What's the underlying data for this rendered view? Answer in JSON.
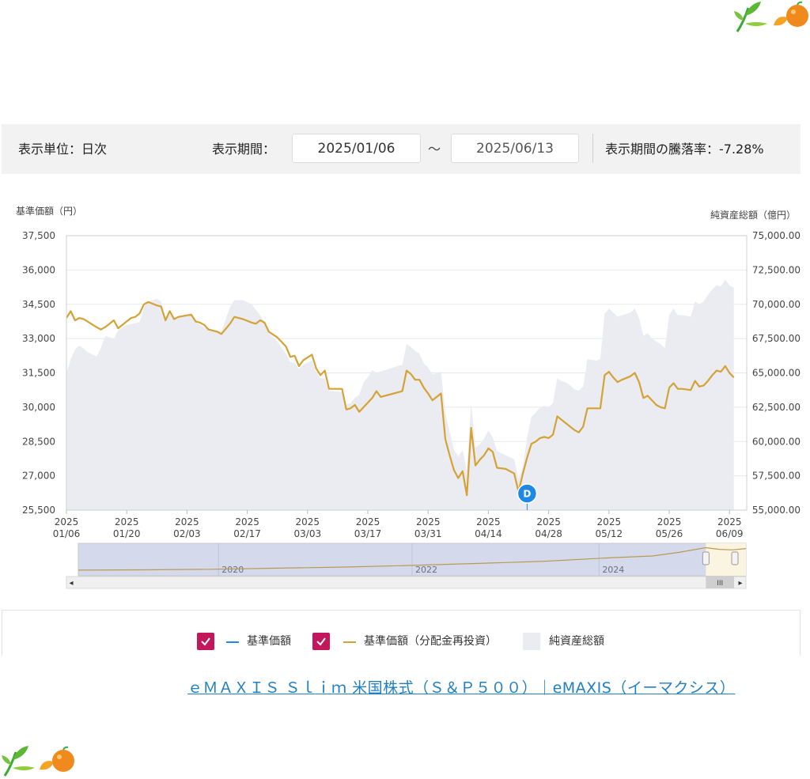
{
  "filter": {
    "unit_label": "表示単位：日次",
    "period_label": "表示期間：",
    "start_date": "2025/01/06",
    "tilde": "～",
    "end_date": "2025/06/13",
    "change_label": "表示期間の騰落率：-7.28%"
  },
  "legend": {
    "item1": "基準価額",
    "item2": "基準価額（分配金再投資）",
    "item3": "純資産総額",
    "checkbox_color": "#c2185b",
    "item1_color": "#1e88e5",
    "item2_color": "#d4a235",
    "area_color": "#eaecf2"
  },
  "link_text": "ｅＭＡＸＩＳ Ｓｌｉｍ 米国株式（Ｓ＆Ｐ５００）｜eMAXIS（イーマクシス）",
  "chart_data": {
    "type": "line",
    "ylabel": "基準価額（円）",
    "y2label": "純資産総額（億円）",
    "ylim": [
      25500,
      37500
    ],
    "y2lim": [
      55000,
      75000
    ],
    "y_ticks": [
      "37,500",
      "36,000",
      "34,500",
      "33,000",
      "31,500",
      "30,000",
      "28,500",
      "27,000",
      "25,500"
    ],
    "y2_ticks": [
      "75,000.00",
      "72,500.00",
      "70,000.00",
      "67,500.00",
      "65,000.00",
      "62,500.00",
      "60,000.00",
      "57,500.00",
      "55,000.00"
    ],
    "x_ticks": [
      {
        "year": "2025",
        "date": "01/06",
        "pos": 0
      },
      {
        "year": "2025",
        "date": "01/20",
        "pos": 14
      },
      {
        "year": "2025",
        "date": "02/03",
        "pos": 28
      },
      {
        "year": "2025",
        "date": "02/17",
        "pos": 42
      },
      {
        "year": "2025",
        "date": "03/03",
        "pos": 56
      },
      {
        "year": "2025",
        "date": "03/17",
        "pos": 70
      },
      {
        "year": "2025",
        "date": "03/31",
        "pos": 84
      },
      {
        "year": "2025",
        "date": "04/14",
        "pos": 98
      },
      {
        "year": "2025",
        "date": "04/28",
        "pos": 112
      },
      {
        "year": "2025",
        "date": "05/12",
        "pos": 126
      },
      {
        "year": "2025",
        "date": "05/26",
        "pos": 140
      },
      {
        "year": "2025",
        "date": "06/09",
        "pos": 154
      }
    ],
    "x_range": [
      0,
      158
    ],
    "series": [
      {
        "name": "基準価額（分配金再投資）",
        "color": "#d4a235",
        "points": [
          [
            0,
            33900
          ],
          [
            1,
            34200
          ],
          [
            2,
            33800
          ],
          [
            3,
            33900
          ],
          [
            4,
            33850
          ],
          [
            7,
            33500
          ],
          [
            8,
            33400
          ],
          [
            9,
            33500
          ],
          [
            11,
            33800
          ],
          [
            12,
            33450
          ],
          [
            13,
            33600
          ],
          [
            15,
            33900
          ],
          [
            16,
            33950
          ],
          [
            17,
            34100
          ],
          [
            18,
            34500
          ],
          [
            19,
            34600
          ],
          [
            21,
            34450
          ],
          [
            22,
            34400
          ],
          [
            23,
            33800
          ],
          [
            24,
            34200
          ],
          [
            25,
            33850
          ],
          [
            26,
            33950
          ],
          [
            29,
            34050
          ],
          [
            30,
            33750
          ],
          [
            31,
            33700
          ],
          [
            32,
            33600
          ],
          [
            33,
            33400
          ],
          [
            35,
            33300
          ],
          [
            36,
            33200
          ],
          [
            38,
            33650
          ],
          [
            39,
            33950
          ],
          [
            41,
            33850
          ],
          [
            43,
            33700
          ],
          [
            44,
            33650
          ],
          [
            45,
            33800
          ],
          [
            46,
            33700
          ],
          [
            47,
            33300
          ],
          [
            49,
            33050
          ],
          [
            50,
            32850
          ],
          [
            51,
            32650
          ],
          [
            52,
            32200
          ],
          [
            53,
            32250
          ],
          [
            54,
            31800
          ],
          [
            55,
            32050
          ],
          [
            57,
            32300
          ],
          [
            58,
            31700
          ],
          [
            59,
            31400
          ],
          [
            60,
            31600
          ],
          [
            61,
            30800
          ],
          [
            64,
            30800
          ],
          [
            65,
            29900
          ],
          [
            66,
            29950
          ],
          [
            67,
            30100
          ],
          [
            68,
            29800
          ],
          [
            71,
            30400
          ],
          [
            72,
            30700
          ],
          [
            73,
            30450
          ],
          [
            75,
            30550
          ],
          [
            77,
            30650
          ],
          [
            78,
            30700
          ],
          [
            79,
            31600
          ],
          [
            80,
            31450
          ],
          [
            81,
            31200
          ],
          [
            82,
            31200
          ],
          [
            83,
            30850
          ],
          [
            84,
            30600
          ],
          [
            85,
            30300
          ],
          [
            86,
            30450
          ],
          [
            87,
            30600
          ],
          [
            88,
            28600
          ],
          [
            89,
            27900
          ],
          [
            90,
            27250
          ],
          [
            91,
            26900
          ],
          [
            92,
            27200
          ],
          [
            93,
            26150
          ],
          [
            94,
            29100
          ],
          [
            95,
            27450
          ],
          [
            96,
            27700
          ],
          [
            97,
            27900
          ],
          [
            98,
            28200
          ],
          [
            99,
            28050
          ],
          [
            100,
            27350
          ],
          [
            102,
            27300
          ],
          [
            104,
            27100
          ],
          [
            105,
            26300
          ],
          [
            106,
            27100
          ],
          [
            107,
            27800
          ],
          [
            108,
            28400
          ],
          [
            109,
            28500
          ],
          [
            110,
            28650
          ],
          [
            111,
            28700
          ],
          [
            112,
            28650
          ],
          [
            113,
            28800
          ],
          [
            114,
            29600
          ],
          [
            115,
            29450
          ],
          [
            116,
            29300
          ],
          [
            117,
            29150
          ],
          [
            118,
            29000
          ],
          [
            119,
            28900
          ],
          [
            120,
            29150
          ],
          [
            121,
            29950
          ],
          [
            123,
            29950
          ],
          [
            124,
            29950
          ],
          [
            125,
            31400
          ],
          [
            126,
            31550
          ],
          [
            127,
            31300
          ],
          [
            128,
            31100
          ],
          [
            129,
            31200
          ],
          [
            131,
            31350
          ],
          [
            132,
            31500
          ],
          [
            133,
            31100
          ],
          [
            134,
            30400
          ],
          [
            135,
            30500
          ],
          [
            136,
            30300
          ],
          [
            137,
            30100
          ],
          [
            138,
            30000
          ],
          [
            139,
            29950
          ],
          [
            140,
            30850
          ],
          [
            141,
            31050
          ],
          [
            142,
            30800
          ],
          [
            143,
            30800
          ],
          [
            145,
            30750
          ],
          [
            146,
            31150
          ],
          [
            147,
            30900
          ],
          [
            148,
            30950
          ],
          [
            149,
            31150
          ],
          [
            150,
            31400
          ],
          [
            151,
            31600
          ],
          [
            152,
            31550
          ],
          [
            153,
            31800
          ],
          [
            154,
            31500
          ],
          [
            155,
            31300
          ]
        ]
      },
      {
        "name": "純資産総額",
        "color": "#eaecf2",
        "points": [
          [
            0,
            65000
          ],
          [
            1,
            66000
          ],
          [
            2,
            66700
          ],
          [
            3,
            67000
          ],
          [
            5,
            66500
          ],
          [
            7,
            66200
          ],
          [
            8,
            66800
          ],
          [
            9,
            67700
          ],
          [
            11,
            67500
          ],
          [
            12,
            68100
          ],
          [
            14,
            68500
          ],
          [
            17,
            68700
          ],
          [
            18,
            69800
          ],
          [
            19,
            70200
          ],
          [
            21,
            70400
          ],
          [
            22,
            70200
          ],
          [
            23,
            68800
          ],
          [
            24,
            69300
          ],
          [
            25,
            68900
          ],
          [
            29,
            69300
          ],
          [
            30,
            68700
          ],
          [
            31,
            68500
          ],
          [
            32,
            68300
          ],
          [
            36,
            68000
          ],
          [
            37,
            68900
          ],
          [
            38,
            69800
          ],
          [
            39,
            70300
          ],
          [
            41,
            70300
          ],
          [
            43,
            70000
          ],
          [
            44,
            69600
          ],
          [
            45,
            69200
          ],
          [
            46,
            68700
          ],
          [
            47,
            67900
          ],
          [
            49,
            67300
          ],
          [
            50,
            66800
          ],
          [
            51,
            66400
          ],
          [
            52,
            65800
          ],
          [
            53,
            65700
          ],
          [
            54,
            65300
          ],
          [
            55,
            65600
          ],
          [
            57,
            65900
          ],
          [
            58,
            65100
          ],
          [
            59,
            64600
          ],
          [
            60,
            64600
          ],
          [
            61,
            63700
          ],
          [
            64,
            63600
          ],
          [
            65,
            62700
          ],
          [
            66,
            62800
          ],
          [
            67,
            63200
          ],
          [
            68,
            63400
          ],
          [
            69,
            64300
          ],
          [
            70,
            64700
          ],
          [
            71,
            65200
          ],
          [
            72,
            65000
          ],
          [
            73,
            65100
          ],
          [
            75,
            65300
          ],
          [
            77,
            65500
          ],
          [
            78,
            65600
          ],
          [
            79,
            67100
          ],
          [
            80,
            66900
          ],
          [
            81,
            66600
          ],
          [
            82,
            66400
          ],
          [
            83,
            65700
          ],
          [
            84,
            65400
          ],
          [
            85,
            64900
          ],
          [
            86,
            65000
          ],
          [
            87,
            65100
          ],
          [
            88,
            62100
          ],
          [
            89,
            60700
          ],
          [
            90,
            59400
          ],
          [
            91,
            58900
          ],
          [
            92,
            59400
          ],
          [
            93,
            57800
          ],
          [
            94,
            62800
          ],
          [
            95,
            59600
          ],
          [
            96,
            59800
          ],
          [
            97,
            60200
          ],
          [
            98,
            60800
          ],
          [
            99,
            60300
          ],
          [
            100,
            59300
          ],
          [
            102,
            59000
          ],
          [
            104,
            58700
          ],
          [
            105,
            57300
          ],
          [
            106,
            58200
          ],
          [
            107,
            60300
          ],
          [
            108,
            61800
          ],
          [
            109,
            62100
          ],
          [
            110,
            62500
          ],
          [
            111,
            62600
          ],
          [
            112,
            62500
          ],
          [
            113,
            62800
          ],
          [
            114,
            64600
          ],
          [
            115,
            64400
          ],
          [
            116,
            64300
          ],
          [
            117,
            64100
          ],
          [
            118,
            63800
          ],
          [
            119,
            63700
          ],
          [
            120,
            64000
          ],
          [
            121,
            66000
          ],
          [
            123,
            65900
          ],
          [
            124,
            66000
          ],
          [
            125,
            69300
          ],
          [
            126,
            69700
          ],
          [
            127,
            69400
          ],
          [
            128,
            69100
          ],
          [
            129,
            69200
          ],
          [
            131,
            69400
          ],
          [
            132,
            69700
          ],
          [
            133,
            69000
          ],
          [
            134,
            67700
          ],
          [
            135,
            67900
          ],
          [
            136,
            67500
          ],
          [
            137,
            67300
          ],
          [
            138,
            67100
          ],
          [
            139,
            66800
          ],
          [
            140,
            69200
          ],
          [
            141,
            69700
          ],
          [
            142,
            69200
          ],
          [
            143,
            69200
          ],
          [
            145,
            69100
          ],
          [
            146,
            70200
          ],
          [
            147,
            70000
          ],
          [
            148,
            70200
          ],
          [
            149,
            70700
          ],
          [
            150,
            71100
          ],
          [
            151,
            71400
          ],
          [
            152,
            71300
          ],
          [
            153,
            71800
          ],
          [
            154,
            71400
          ],
          [
            155,
            71200
          ]
        ]
      }
    ],
    "marker": {
      "label": "D",
      "x": 107
    },
    "navigator": {
      "year_labels": [
        {
          "text": "2020",
          "pos": 0.21
        },
        {
          "text": "2022",
          "pos": 0.5
        },
        {
          "text": "2024",
          "pos": 0.78
        }
      ],
      "selection_start": 0.94,
      "trend": [
        [
          0,
          0.09
        ],
        [
          0.1,
          0.1
        ],
        [
          0.2,
          0.12
        ],
        [
          0.3,
          0.16
        ],
        [
          0.4,
          0.2
        ],
        [
          0.5,
          0.26
        ],
        [
          0.6,
          0.33
        ],
        [
          0.7,
          0.41
        ],
        [
          0.8,
          0.54
        ],
        [
          0.86,
          0.6
        ],
        [
          0.9,
          0.73
        ],
        [
          0.94,
          0.9
        ],
        [
          0.96,
          0.84
        ],
        [
          0.98,
          0.82
        ],
        [
          1,
          0.87
        ]
      ],
      "scroll_handle": "III",
      "left_arrow": "◂",
      "right_arrow": "▸"
    }
  }
}
